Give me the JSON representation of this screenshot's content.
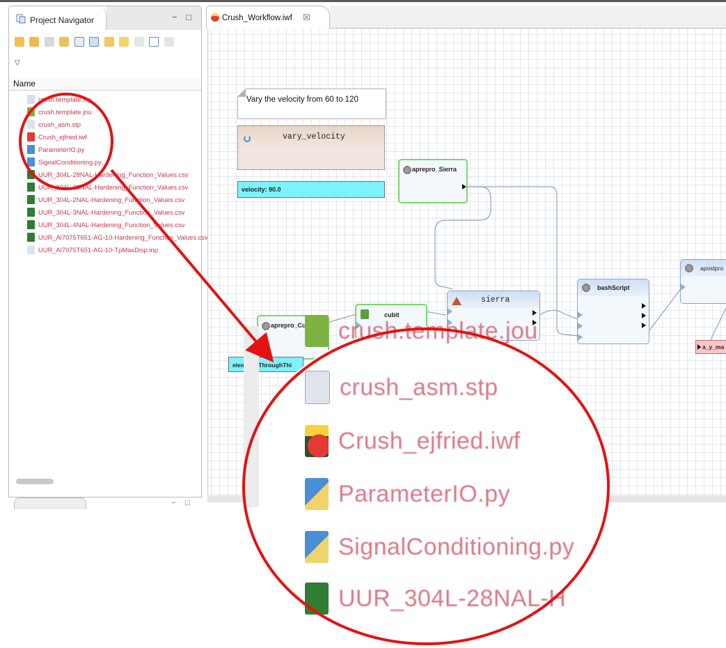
{
  "navigator": {
    "title": "Project Navigator",
    "column_header": "Name",
    "dropdown_icon": "▽",
    "minimize_icon": "−",
    "maximize_icon": "□",
    "files": [
      {
        "label": "crush.template.inp",
        "icon": "inp-file-icon",
        "color": "#d9dfe8"
      },
      {
        "label": "crush.template.jou",
        "icon": "cubit-jou-icon",
        "color": "#7cb342"
      },
      {
        "label": "crush_asm.stp",
        "icon": "stp-file-icon",
        "color": "#dfe4ec"
      },
      {
        "label": "Crush_ejfried.iwf",
        "icon": "workflow-file-icon",
        "color": "#e53935"
      },
      {
        "label": "ParameterIO.py",
        "icon": "python-file-icon",
        "color": "#4a8fd6"
      },
      {
        "label": "SignalConditioning.py",
        "icon": "python-file-icon",
        "color": "#4a8fd6"
      },
      {
        "label": "UUR_304L-28NAL-Hardening_Function_Values.csv",
        "icon": "csv-file-icon",
        "color": "#2e7d32"
      },
      {
        "label": "UUR_304L-29NAL-Hardening_Function_Values.csv",
        "icon": "csv-file-icon",
        "color": "#2e7d32"
      },
      {
        "label": "UUR_304L-2NAL-Hardening_Function_Values.csv",
        "icon": "csv-file-icon",
        "color": "#2e7d32"
      },
      {
        "label": "UUR_304L-3NAL-Hardening_Function_Values.csv",
        "icon": "csv-file-icon",
        "color": "#2e7d32"
      },
      {
        "label": "UUR_304L-4NAL-Hardening_Function_Values.csv",
        "icon": "csv-file-icon",
        "color": "#2e7d32"
      },
      {
        "label": "UUR_Al7075T651-AG-10-Hardening_Function_Values.csv",
        "icon": "csv-file-icon",
        "color": "#2e7d32"
      },
      {
        "label": "UUR_Al7075T651-AG-10-TpMaxDisp.inp",
        "icon": "inp-file-icon",
        "color": "#dfe4ec"
      }
    ]
  },
  "editor": {
    "tab_label": "Crush_Workflow.iwf",
    "tab_close": "☒",
    "note_text": "Vary the velocity from 60 to 120",
    "vary_node": "vary_velocity",
    "velocity_param": "velocity: 90.0",
    "elements_param": "elementsThroughThi",
    "response_label": "a_y_ma",
    "nodes": {
      "aprepro_sierra": "aprepro_Sierra",
      "aprepro_cubit": "aprepro_Cubit",
      "cubit": "cubit",
      "sierra": "sierra",
      "bashscript": "bashScript",
      "apostpro": "apostpro"
    }
  },
  "zoom": {
    "rows": [
      {
        "label": "crush.template.jou",
        "icon": "cubit-jou-icon",
        "color": "#7cb342"
      },
      {
        "label": "crush_asm.stp",
        "icon": "stp-file-icon",
        "color": "#dfe4ec"
      },
      {
        "label": "Crush_ejfried.iwf",
        "icon": "workflow-file-icon",
        "color": "#e53935"
      },
      {
        "label": "ParameterIO.py",
        "icon": "python-file-icon",
        "color": "#4a8fd6"
      },
      {
        "label": "SignalConditioning.py",
        "icon": "python-file-icon",
        "color": "#4a8fd6"
      },
      {
        "label": "UUR_304L-28NAL-H",
        "icon": "csv-file-icon",
        "color": "#2e7d32"
      }
    ]
  },
  "colors": {
    "annotation_red": "#e41212",
    "file_text": "#c23a4b",
    "param_cyan": "#7df2fb",
    "node_green_border": "#7bd46c",
    "wire": "#8fa3c0"
  }
}
